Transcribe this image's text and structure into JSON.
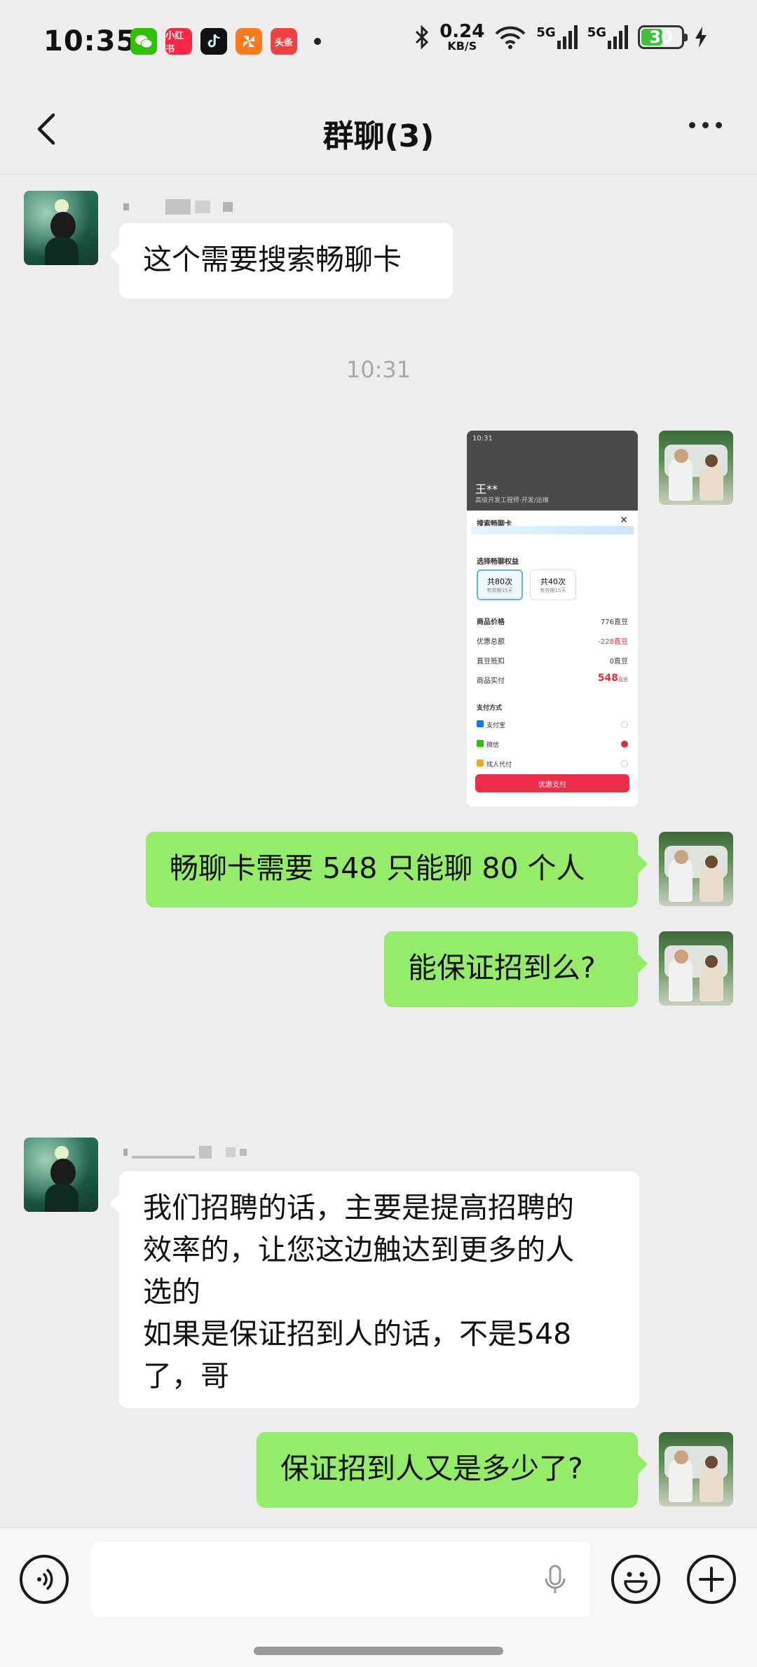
{
  "status_bar": {
    "time": "10:35",
    "apps": [
      {
        "name": "wechat-icon",
        "label": "",
        "color": "#2dc100"
      },
      {
        "name": "xiaohongshu-icon",
        "label": "小红书",
        "color": "#ff2442"
      },
      {
        "name": "tiktok-icon",
        "label": "",
        "color": "#111111"
      },
      {
        "name": "pinwheel-app-icon",
        "label": "",
        "color": "#ff7a1a"
      },
      {
        "name": "toutiao-icon",
        "label": "头条",
        "color": "#f04142"
      }
    ],
    "net_speed": "0.24",
    "net_speed_unit": "KB/S",
    "signal1": "5G",
    "signal2": "5G",
    "battery": "30"
  },
  "nav": {
    "title": "群聊(3)"
  },
  "messages": {
    "m1": "这个需要搜索畅聊卡",
    "timestamp": "10:31",
    "m3": "畅聊卡需要 548 只能聊 80 个人",
    "m4": "能保证招到么?",
    "m5": "我们招聘的话，主要是提高招聘的\n效率的，让您这边触达到更多的人\n选的\n如果是保证招到人的话，不是548\n了，哥",
    "m6": "保证招到人又是多少了?"
  },
  "screenshot": {
    "status": "10:31",
    "name": "王**",
    "subtitle": "高级开发工程师·开发/运维",
    "sheet_title": "搜索畅聊卡",
    "section_title": "选择畅聊权益",
    "option1": "共80次",
    "option1_sub": "有效期35天",
    "option2": "共40次",
    "option2_sub": "有效期15天",
    "price_label": "商品价格",
    "price_value": "776直豆",
    "discount_label": "优惠总额",
    "discount_value": "-228直豆",
    "deduct_label": "直豆抵扣",
    "deduct_value": "0直豆",
    "pay_label": "商品实付",
    "pay_value": "548",
    "pay_unit": "直豆",
    "payment_title": "支付方式",
    "pay_alipay": "支付宝",
    "pay_wechat": "微信",
    "pay_friend": "找人代付",
    "confirm": "优惠支付"
  },
  "colors": {
    "bubble_out": "#95ec69",
    "bubble_in": "#ffffff",
    "background": "#ededed"
  }
}
